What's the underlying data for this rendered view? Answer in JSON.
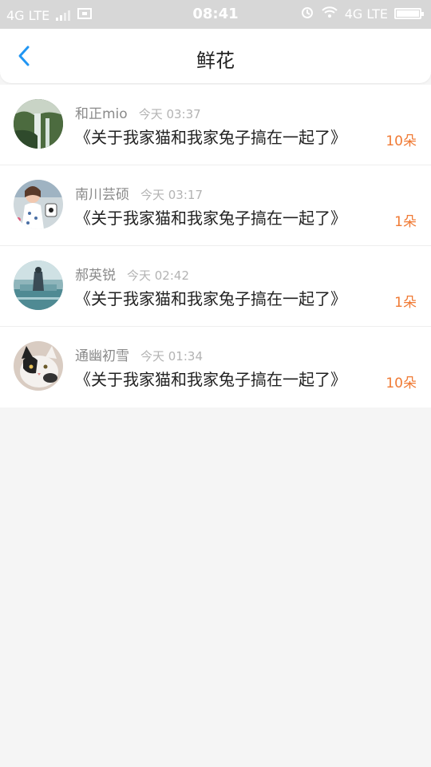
{
  "statusbar": {
    "left_network": "4G LTE",
    "time": "08:41",
    "right_network": "4G LTE"
  },
  "header": {
    "title": "鲜花"
  },
  "items": [
    {
      "user": "和正mio",
      "time": "今天 03:37",
      "title": "《关于我家猫和我家兔子搞在一起了》",
      "count": "10朵"
    },
    {
      "user": "南川芸硕",
      "time": "今天 03:17",
      "title": "《关于我家猫和我家兔子搞在一起了》",
      "count": "1朵"
    },
    {
      "user": "郝英锐",
      "time": "今天 02:42",
      "title": "《关于我家猫和我家兔子搞在一起了》",
      "count": "1朵"
    },
    {
      "user": "通幽初雪",
      "time": "今天 01:34",
      "title": "《关于我家猫和我家兔子搞在一起了》",
      "count": "10朵"
    }
  ],
  "colors": {
    "accent": "#2196f3",
    "count": "#f07a34"
  }
}
